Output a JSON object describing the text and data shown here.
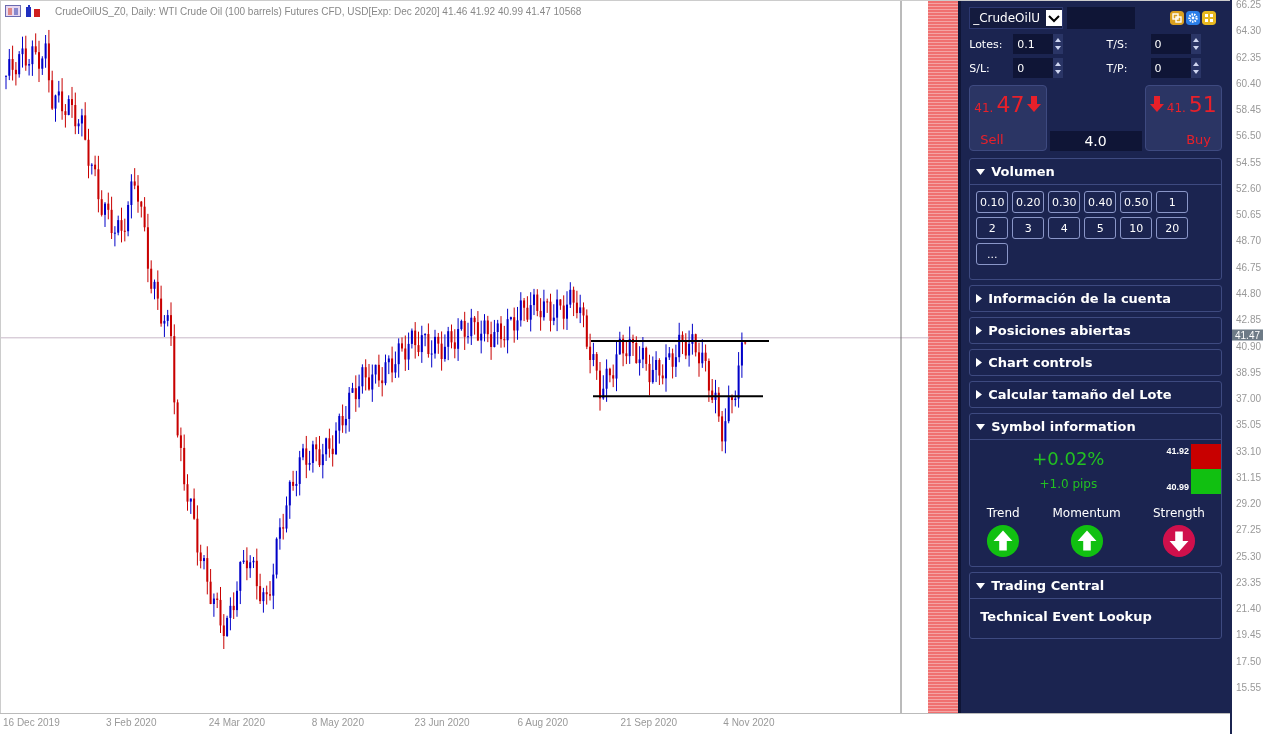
{
  "chart": {
    "header": "CrudeOilUS_Z0, Daily:  WTI Crude Oil (100 barrels) Futures CFD, USD[Exp: Dec 2020]  41.46 41.92 40.99 41.47  10568",
    "price_labels": [
      "66.25",
      "64.30",
      "62.35",
      "60.40",
      "58.45",
      "56.50",
      "54.55",
      "52.60",
      "50.65",
      "48.70",
      "46.75",
      "44.80",
      "42.85",
      "40.90",
      "38.95",
      "37.00",
      "35.05",
      "33.10",
      "31.15",
      "29.20",
      "27.25",
      "25.30",
      "23.35",
      "21.40",
      "19.45",
      "17.50",
      "15.55"
    ],
    "current_price": "41.47",
    "date_labels": [
      "16 Dec 2019",
      "3 Feb 2020",
      "24 Mar 2020",
      "8 May 2020",
      "23 Jun 2020",
      "6 Aug 2020",
      "21 Sep 2020",
      "4 Nov 2020"
    ]
  },
  "panel": {
    "symbol": "_CrudeOilU",
    "fields": [
      {
        "label": "Lotes:",
        "value": "0.1"
      },
      {
        "label": "T/S:",
        "value": "0"
      },
      {
        "label": "S/L:",
        "value": "0"
      },
      {
        "label": "T/P:",
        "value": "0"
      }
    ],
    "sell": {
      "price_small": "41.",
      "price_big": "47",
      "label": "Sell"
    },
    "buy": {
      "price_small": "41.",
      "price_big": "51",
      "label": "Buy"
    },
    "spread": "4.0",
    "sections": [
      {
        "kind": "volume",
        "title": "Volumen",
        "expanded": true,
        "buttons": [
          "0.10",
          "0.20",
          "0.30",
          "0.40",
          "0.50",
          "1",
          "2",
          "3",
          "4",
          "5",
          "10",
          "20",
          "..."
        ]
      },
      {
        "title": "Información de la cuenta",
        "expanded": false
      },
      {
        "title": "Posiciones abiertas",
        "expanded": false
      },
      {
        "title": "Chart controls",
        "expanded": false
      },
      {
        "title": "Calcular tamaño del Lote",
        "expanded": false
      },
      {
        "kind": "symbol",
        "title": "Symbol information",
        "expanded": true,
        "change_percent": "+0.02%",
        "change_pips": "+1.0 pips",
        "high": "41.92",
        "low": "40.99",
        "indicators": [
          {
            "label": "Trend",
            "up": true
          },
          {
            "label": "Momentum",
            "up": true
          },
          {
            "label": "Strength",
            "up": false
          }
        ]
      },
      {
        "kind": "links",
        "title": "Trading Central",
        "expanded": true,
        "items": [
          "Technical Event Lookup"
        ]
      }
    ]
  }
}
